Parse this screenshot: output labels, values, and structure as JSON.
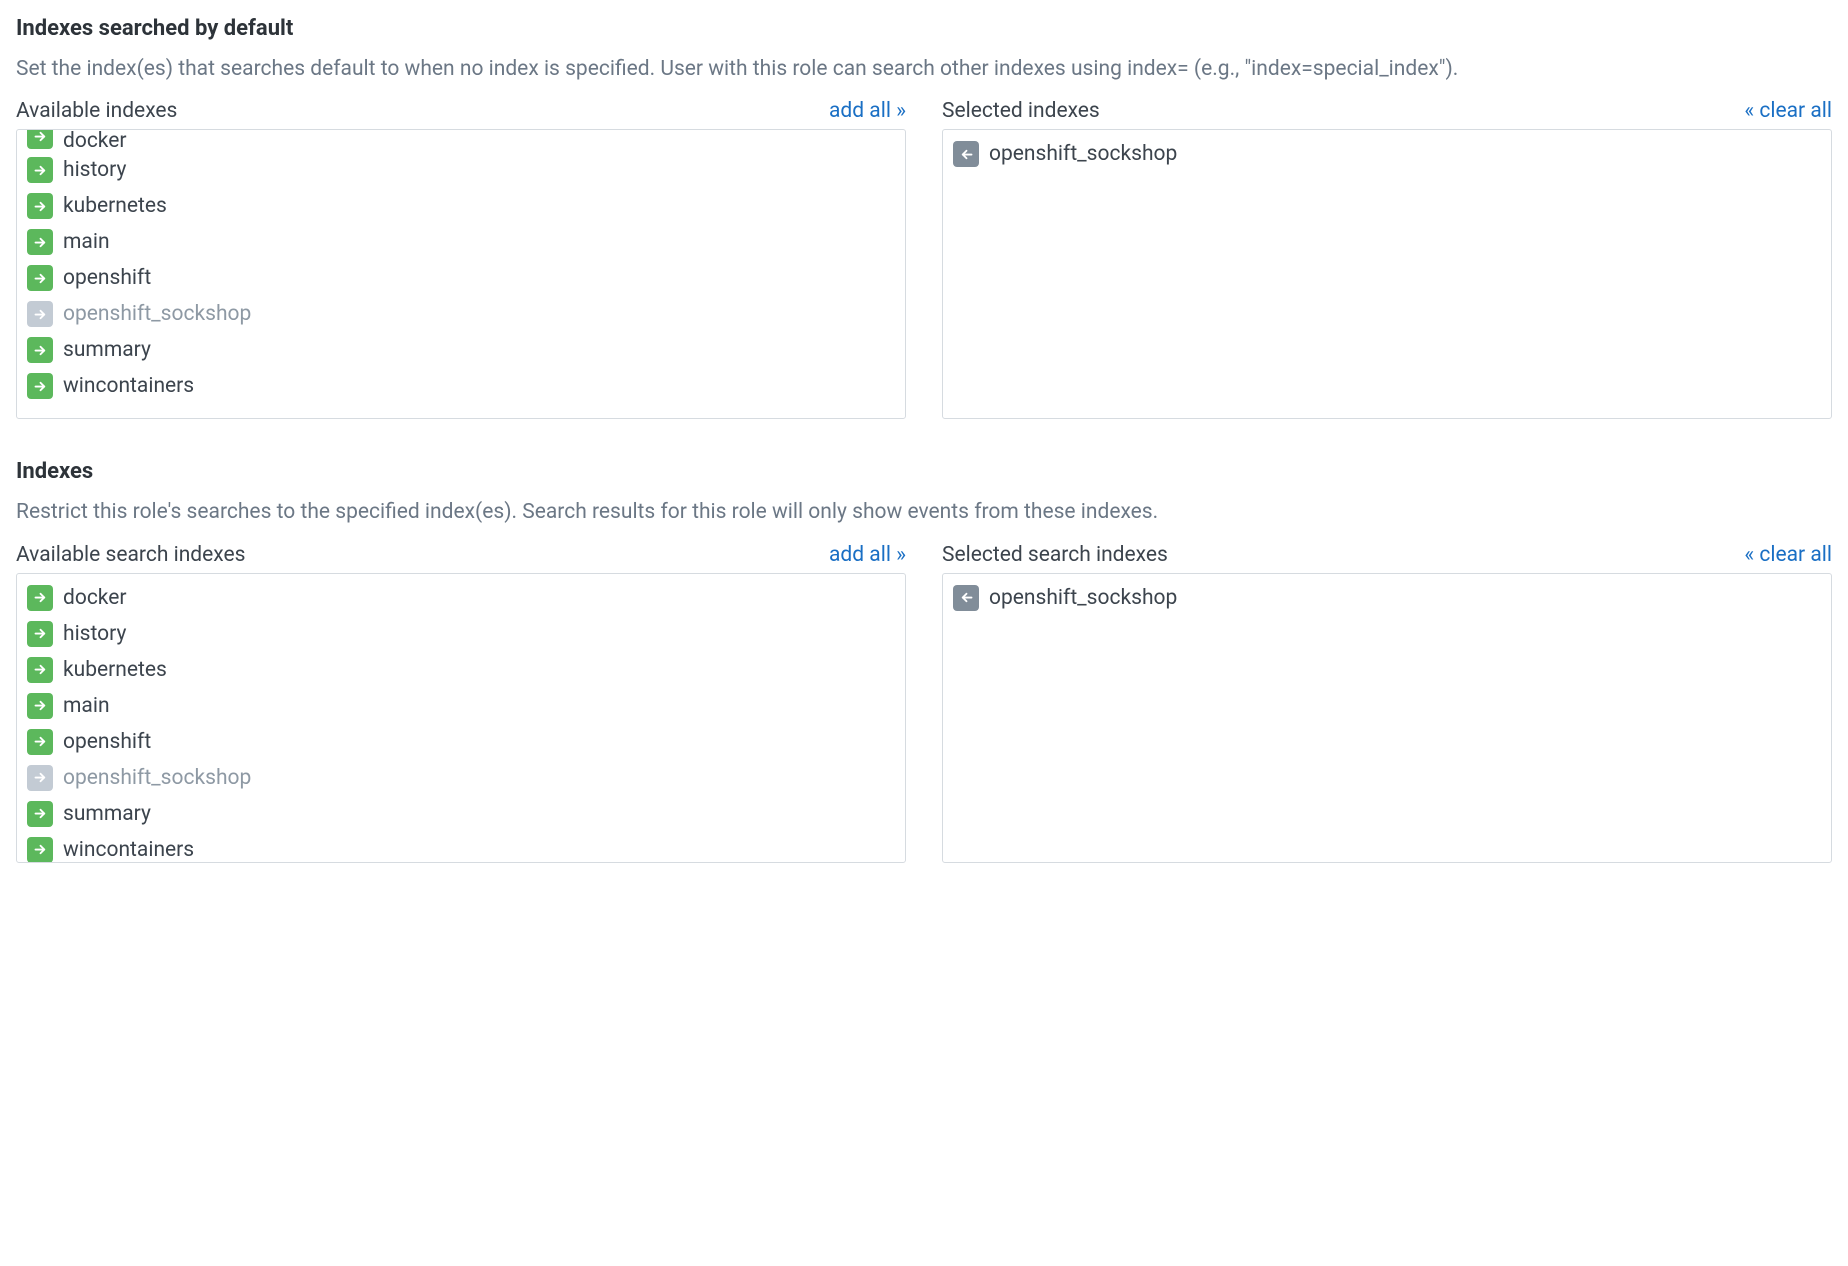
{
  "section1": {
    "title": "Indexes searched by default",
    "description": "Set the index(es) that searches default to when no index is specified. User with this role can search other indexes using index= (e.g., \"index=special_index\").",
    "available": {
      "label": "Available indexes",
      "action": "add all »",
      "items": [
        {
          "name": "docker",
          "state": "available"
        },
        {
          "name": "history",
          "state": "available"
        },
        {
          "name": "kubernetes",
          "state": "available"
        },
        {
          "name": "main",
          "state": "available"
        },
        {
          "name": "openshift",
          "state": "available"
        },
        {
          "name": "openshift_sockshop",
          "state": "disabled"
        },
        {
          "name": "summary",
          "state": "available"
        },
        {
          "name": "wincontainers",
          "state": "available"
        }
      ]
    },
    "selected": {
      "label": "Selected indexes",
      "action": "« clear all",
      "items": [
        {
          "name": "openshift_sockshop",
          "state": "selected"
        }
      ]
    }
  },
  "section2": {
    "title": "Indexes",
    "description": "Restrict this role's searches to the specified index(es). Search results for this role will only show events from these indexes.",
    "available": {
      "label": "Available search indexes",
      "action": "add all »",
      "items": [
        {
          "name": "docker",
          "state": "available"
        },
        {
          "name": "history",
          "state": "available"
        },
        {
          "name": "kubernetes",
          "state": "available"
        },
        {
          "name": "main",
          "state": "available"
        },
        {
          "name": "openshift",
          "state": "available"
        },
        {
          "name": "openshift_sockshop",
          "state": "disabled"
        },
        {
          "name": "summary",
          "state": "available"
        },
        {
          "name": "wincontainers",
          "state": "available"
        }
      ]
    },
    "selected": {
      "label": "Selected search indexes",
      "action": "« clear all",
      "items": [
        {
          "name": "openshift_sockshop",
          "state": "selected"
        }
      ]
    }
  }
}
